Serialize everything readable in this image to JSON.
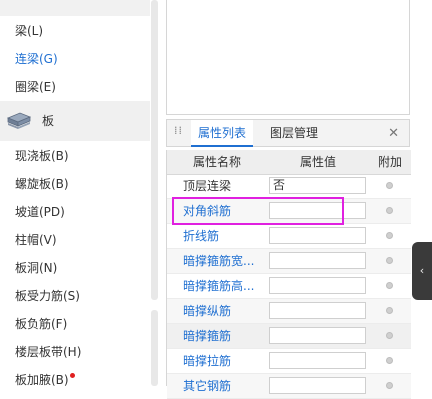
{
  "left_panel": {
    "items_top": [
      "梁(L)",
      "连梁(G)",
      "圈梁(E)"
    ],
    "active_index": 1,
    "group": {
      "label": "板",
      "icon": "slab-icon"
    },
    "items": [
      "现浇板(B)",
      "螺旋板(B)",
      "坡道(PD)",
      "柱帽(V)",
      "板洞(N)",
      "板受力筋(S)",
      "板负筋(F)",
      "楼层板带(H)",
      "板加腋(B)"
    ],
    "dot_on_item": "板加腋(B)"
  },
  "properties_panel": {
    "tabs": [
      "属性列表",
      "图层管理"
    ],
    "active_tab": "属性列表",
    "close_icon": "close-icon",
    "columns": [
      "属性名称",
      "属性值",
      "附加"
    ],
    "rows": [
      {
        "name": "顶层连梁",
        "value": "否",
        "style": "dark"
      },
      {
        "name": "对角斜筋",
        "value": "",
        "style": "blue"
      },
      {
        "name": "折线筋",
        "value": "",
        "style": "blue"
      },
      {
        "name": "暗撑箍筋宽...",
        "value": "",
        "style": "blue"
      },
      {
        "name": "暗撑箍筋高...",
        "value": "",
        "style": "blue"
      },
      {
        "name": "暗撑纵筋",
        "value": "",
        "style": "blue"
      },
      {
        "name": "暗撑箍筋",
        "value": "",
        "style": "blue"
      },
      {
        "name": "暗撑拉筋",
        "value": "",
        "style": "blue"
      },
      {
        "name": "其它钢筋",
        "value": "",
        "style": "blue"
      }
    ],
    "highlighted_row": "对角斜筋",
    "highlight_color": "#e020e0"
  },
  "dock_button": {
    "icon": "chevron-left-icon",
    "glyph": "‹"
  },
  "colors": {
    "accent": "#1f6fd1",
    "alert_dot": "#e02020"
  }
}
